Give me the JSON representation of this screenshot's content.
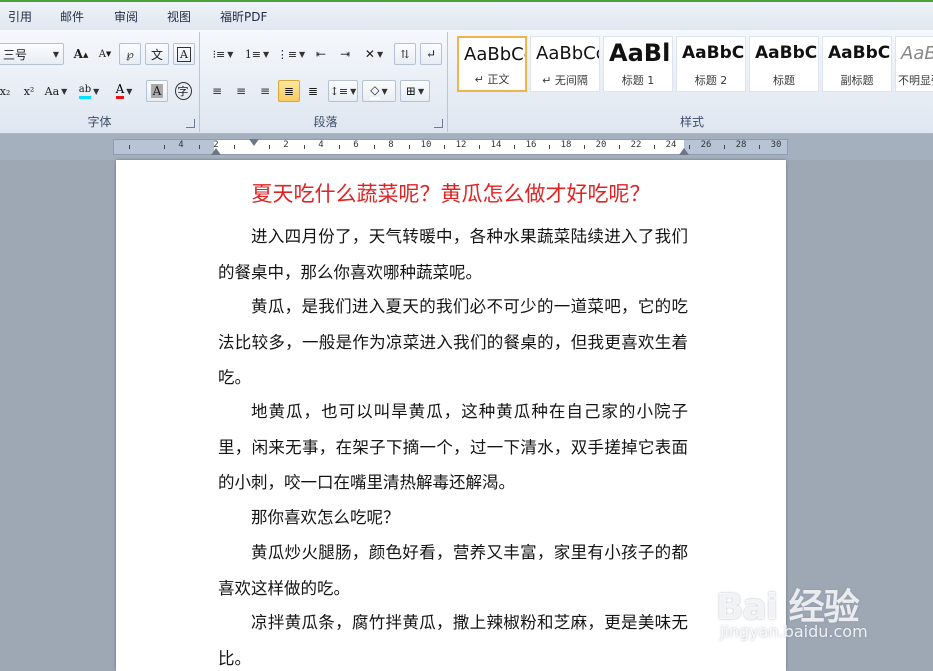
{
  "tabs": [
    "引用",
    "邮件",
    "审阅",
    "视图",
    "福昕PDF"
  ],
  "ribbon": {
    "font_group": {
      "label": "字体",
      "font_size": "三号",
      "grow_font": "A",
      "shrink_font": "A",
      "pinyin": "文",
      "char_border": "A",
      "subscript": "x₂",
      "superscript": "x²",
      "change_case": "Aa",
      "highlight": "ab",
      "font_color": "A",
      "char_shading": "A",
      "enclose": "字"
    },
    "paragraph_group": {
      "label": "段落"
    },
    "styles_group": {
      "label": "样式",
      "styles": [
        {
          "sample": "AaBbCcDc",
          "name": "↵ 正文"
        },
        {
          "sample": "AaBbCcDc",
          "name": "↵ 无间隔"
        },
        {
          "sample": "AaBl",
          "name": "标题 1"
        },
        {
          "sample": "AaBbC",
          "name": "标题 2"
        },
        {
          "sample": "AaBbC",
          "name": "标题"
        },
        {
          "sample": "AaBbC",
          "name": "副标题"
        },
        {
          "sample": "AaBb",
          "name": "不明显强调"
        }
      ]
    }
  },
  "ruler": {
    "labels": [
      "4",
      "2",
      "2",
      "4",
      "6",
      "8",
      "10",
      "12",
      "14",
      "16",
      "18",
      "20",
      "22",
      "24",
      "26",
      "28",
      "30"
    ]
  },
  "document": {
    "title": "夏天吃什么蔬菜呢？黄瓜怎么做才好吃呢？",
    "paragraphs": [
      "进入四月份了，天气转暖中，各种水果蔬菜陆续进入了我们的餐桌中，那么你喜欢哪种蔬菜呢。",
      "黄瓜，是我们进入夏天的我们必不可少的一道菜吧，它的吃法比较多，一般是作为凉菜进入我们的餐桌的，但我更喜欢生着吃。",
      "地黄瓜，也可以叫旱黄瓜，这种黄瓜种在自己家的小院子里，闲来无事，在架子下摘一个，过一下清水，双手搓掉它表面的小刺，咬一口在嘴里清热解毒还解渴。",
      "那你喜欢怎么吃呢？",
      "黄瓜炒火腿肠，颜色好看，营养又丰富，家里有小孩子的都喜欢这样做的吃。",
      "凉拌黄瓜条，腐竹拌黄瓜，撒上辣椒粉和芝麻，更是美味无比。"
    ]
  },
  "watermark": {
    "main": "Bai 经验",
    "sub": "jingyan.baidu.com"
  },
  "colors": {
    "title": "#e02323",
    "accent": "#4aa33a",
    "selected_style": "#f2b44a"
  }
}
